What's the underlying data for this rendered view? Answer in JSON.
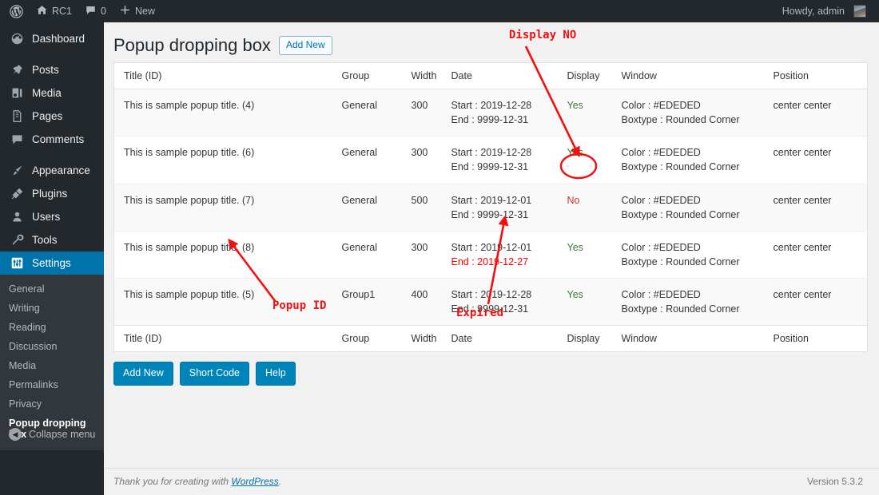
{
  "adminbar": {
    "logo_icon": "wordpress-logo-icon",
    "site_icon": "home-icon",
    "site_name": "RC1",
    "comments_icon": "comment-bubble-icon",
    "comments_count": "0",
    "new_icon": "plus-icon",
    "new_label": "New",
    "howdy": "Howdy, admin",
    "avatar_icon": "avatar-image"
  },
  "sidebar": {
    "items": [
      {
        "label": "Dashboard",
        "icon": "dashboard-icon",
        "current": false
      },
      {
        "label": "Posts",
        "icon": "pin-icon",
        "current": false
      },
      {
        "label": "Media",
        "icon": "media-icon",
        "current": false
      },
      {
        "label": "Pages",
        "icon": "pages-icon",
        "current": false
      },
      {
        "label": "Comments",
        "icon": "comment-bubble-icon",
        "current": false
      },
      {
        "label": "Appearance",
        "icon": "brush-icon",
        "current": false
      },
      {
        "label": "Plugins",
        "icon": "plug-icon",
        "current": false
      },
      {
        "label": "Users",
        "icon": "user-icon",
        "current": false
      },
      {
        "label": "Tools",
        "icon": "wrench-icon",
        "current": false
      },
      {
        "label": "Settings",
        "icon": "settings-sliders-icon",
        "current": true
      }
    ],
    "submenu": [
      {
        "label": "General",
        "current": false
      },
      {
        "label": "Writing",
        "current": false
      },
      {
        "label": "Reading",
        "current": false
      },
      {
        "label": "Discussion",
        "current": false
      },
      {
        "label": "Media",
        "current": false
      },
      {
        "label": "Permalinks",
        "current": false
      },
      {
        "label": "Privacy",
        "current": false
      },
      {
        "label": "Popup dropping box",
        "current": true
      }
    ],
    "collapse_label": "Collapse menu",
    "collapse_icon": "chevron-left-circle-icon"
  },
  "page": {
    "title": "Popup dropping box",
    "add_new_top": "Add New"
  },
  "table": {
    "columns": [
      "Title (ID)",
      "Group",
      "Width",
      "Date",
      "Display",
      "Window",
      "Position"
    ],
    "rows": [
      {
        "title": "This is sample popup title. (4)",
        "group": "General",
        "width": "300",
        "date_start": "Start : 2019-12-28",
        "date_end": "End : 9999-12-31",
        "date_end_expired": false,
        "display": "Yes",
        "window_color": "Color : #EDEDED",
        "window_boxtype": "Boxtype : Rounded Corner",
        "position": "center center"
      },
      {
        "title": "This is sample popup title. (6)",
        "group": "General",
        "width": "300",
        "date_start": "Start : 2019-12-28",
        "date_end": "End : 9999-12-31",
        "date_end_expired": false,
        "display": "Yes",
        "window_color": "Color : #EDEDED",
        "window_boxtype": "Boxtype : Rounded Corner",
        "position": "center center"
      },
      {
        "title": "This is sample popup title. (7)",
        "group": "General",
        "width": "500",
        "date_start": "Start : 2019-12-01",
        "date_end": "End : 9999-12-31",
        "date_end_expired": false,
        "display": "No",
        "window_color": "Color : #EDEDED",
        "window_boxtype": "Boxtype : Rounded Corner",
        "position": "center center"
      },
      {
        "title": "This is sample popup title. (8)",
        "group": "General",
        "width": "300",
        "date_start": "Start : 2019-12-01",
        "date_end": "End : 2019-12-27",
        "date_end_expired": true,
        "display": "Yes",
        "window_color": "Color : #EDEDED",
        "window_boxtype": "Boxtype : Rounded Corner",
        "position": "center center"
      },
      {
        "title": "This is sample popup title. (5)",
        "group": "Group1",
        "width": "400",
        "date_start": "Start : 2019-12-28",
        "date_end": "End : 9999-12-31",
        "date_end_expired": false,
        "display": "Yes",
        "window_color": "Color : #EDEDED",
        "window_boxtype": "Boxtype : Rounded Corner",
        "position": "center center"
      }
    ]
  },
  "buttons": {
    "add_new": "Add New",
    "short_code": "Short Code",
    "help": "Help"
  },
  "footer": {
    "thanks_prefix": "Thank you for creating with ",
    "wordpress_link": "WordPress",
    "thanks_suffix": ".",
    "version": "Version 5.3.2"
  },
  "annotations": {
    "color": "#f30f0f",
    "display_no": "Display NO",
    "popup_id": "Popup ID",
    "expired": "Expired"
  }
}
